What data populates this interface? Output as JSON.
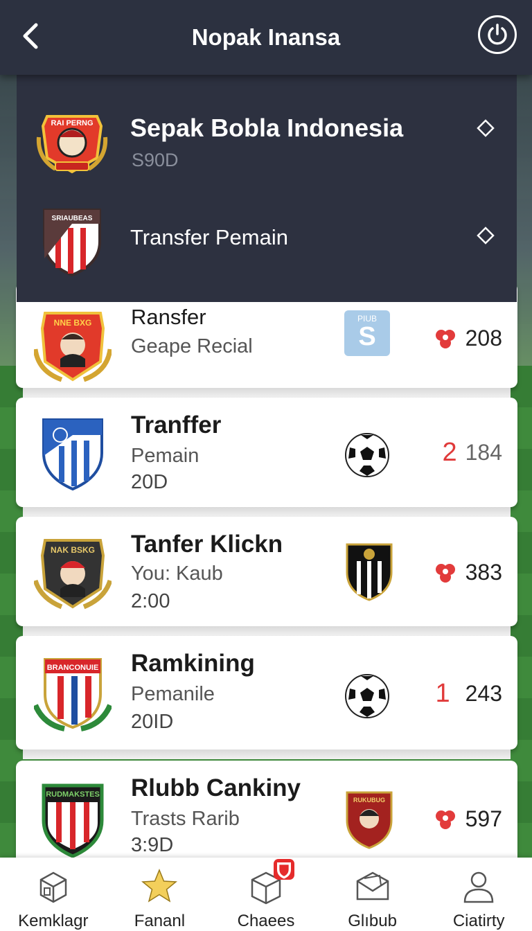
{
  "header": {
    "title": "Nopak Inansa"
  },
  "panel": {
    "items": [
      {
        "title": "Sepak Bobla Indonesia",
        "subtitle": "S90D",
        "crest_text": "RAI PERNG"
      },
      {
        "title": "Transfer Pemain",
        "crest_text": "SRIAUBEAS"
      }
    ]
  },
  "cards": [
    {
      "title": "Ransfer",
      "subtitle": "Geape Recial",
      "time": "",
      "crest_text": "NNE BXG",
      "mid_icon": "plub-s-icon",
      "mid_label": "PIUB",
      "mid_letter": "S",
      "count_prefix": "",
      "count_icon": "red-flower-icon",
      "count": "208"
    },
    {
      "title": "Tranffer",
      "subtitle": "Pemain",
      "time": "20D",
      "crest_text": "",
      "mid_icon": "soccer-ball-icon",
      "count_prefix": "2",
      "count_icon": "",
      "count": "184"
    },
    {
      "title": "Tanfer Klickn",
      "subtitle": "You: Kaub",
      "time": "2:00",
      "crest_text": "NAK BSKG",
      "mid_icon": "black-white-crest-icon",
      "count_prefix": "",
      "count_icon": "red-flower-icon",
      "count": "383"
    },
    {
      "title": "Ramkining",
      "subtitle": "Pemanile",
      "time": "20ID",
      "crest_text": "BRANCONUIE",
      "mid_icon": "soccer-ball-icon",
      "count_prefix": "1",
      "count_icon": "",
      "count": "243"
    },
    {
      "title": "Rlubb Cankiny",
      "subtitle": "Trasts Rarib",
      "time": "3:9D",
      "crest_text": "RUDMAKSTES",
      "mid_icon": "red-crest-icon",
      "mid_label": "RUKUBUG",
      "count_prefix": "",
      "count_icon": "red-flower-icon",
      "count": "597"
    }
  ],
  "bottom_nav": [
    {
      "label": "Kemklagr",
      "icon": "package-icon"
    },
    {
      "label": "Fananl",
      "icon": "star-icon"
    },
    {
      "label": "Chaees",
      "icon": "box-icon",
      "badge": true
    },
    {
      "label": "Glıbub",
      "icon": "envelope-icon"
    },
    {
      "label": "Ciatirty",
      "icon": "person-icon"
    }
  ],
  "colors": {
    "topbar": "#2c3140",
    "accent_red": "#e03a3a",
    "star": "#f3cf5b"
  }
}
